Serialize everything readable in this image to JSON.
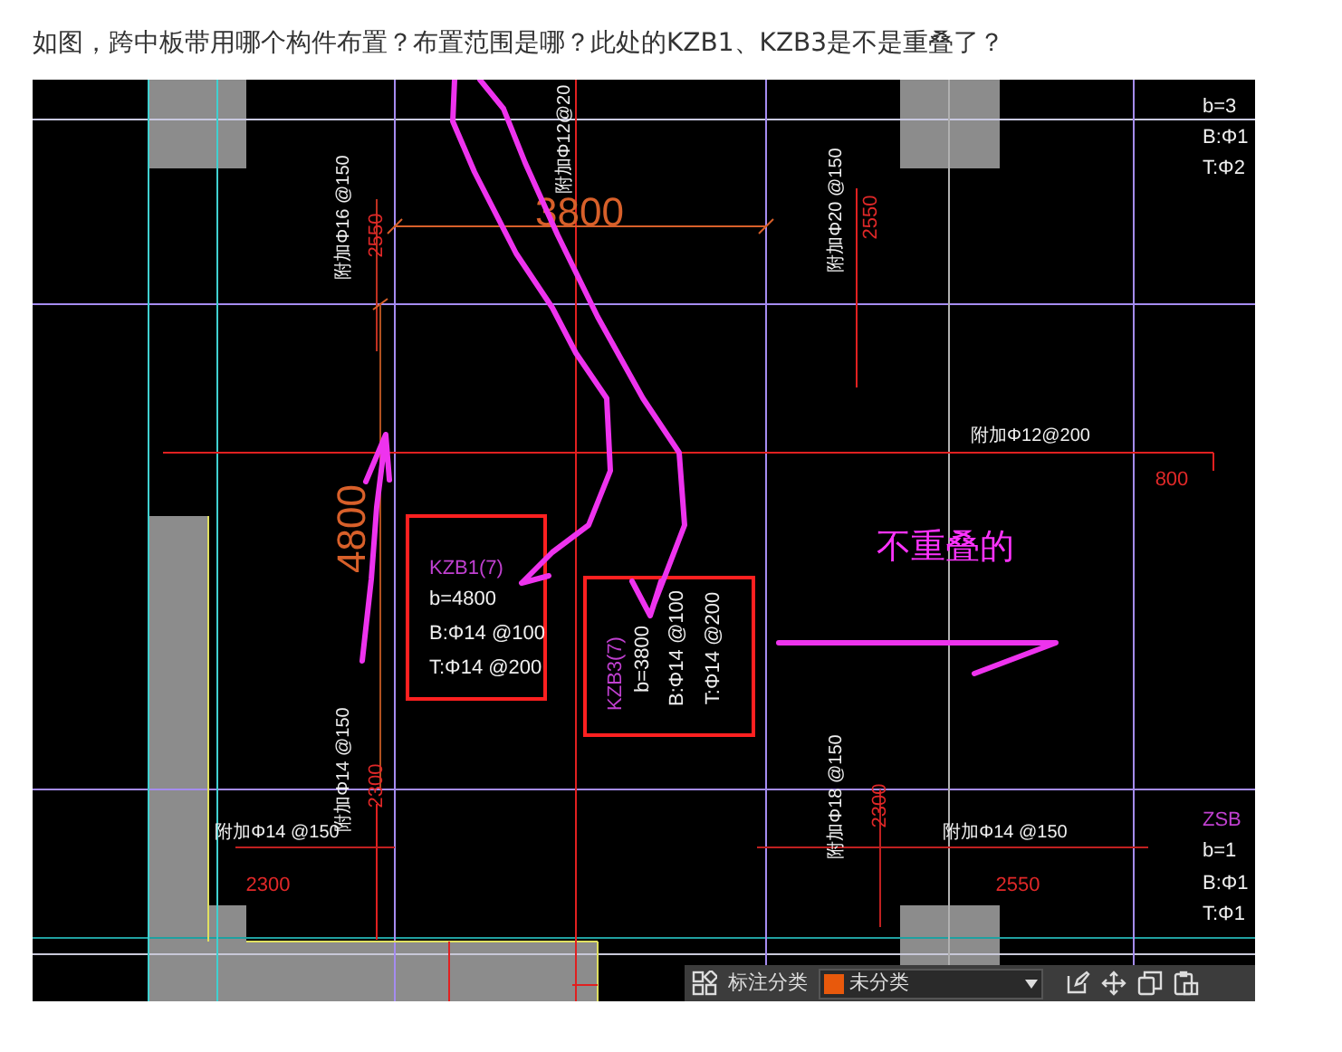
{
  "question": {
    "text": "如图，跨中板带用哪个构件布置？布置范围是哪？此处的KZB1、KZB3是不是重叠了？"
  },
  "cad_drawing": {
    "labels": [
      {
        "text": "附加Φ16 @150",
        "kind": "rebar"
      },
      {
        "text": "2550",
        "kind": "dimension"
      },
      {
        "text": "附加Φ12@20",
        "kind": "rebar"
      },
      {
        "text": "3800",
        "kind": "span"
      },
      {
        "text": "附加Φ20 @150",
        "kind": "rebar"
      },
      {
        "text": "2550",
        "kind": "dimension"
      },
      {
        "text": "b=3",
        "kind": "strip_spec"
      },
      {
        "text": "B:Φ1",
        "kind": "strip_spec"
      },
      {
        "text": "T:Φ2",
        "kind": "strip_spec"
      },
      {
        "text": "附加Φ12@200",
        "kind": "rebar"
      },
      {
        "text": "800",
        "kind": "dimension"
      },
      {
        "text": "4800",
        "kind": "span"
      },
      {
        "text": "KZB1(7)",
        "kind": "strip_name"
      },
      {
        "text": "b=4800",
        "kind": "strip_spec"
      },
      {
        "text": "B:Φ14 @100",
        "kind": "strip_spec"
      },
      {
        "text": "T:Φ14 @200",
        "kind": "strip_spec"
      },
      {
        "text": "KZB3(7)",
        "kind": "strip_name"
      },
      {
        "text": "b=3800",
        "kind": "strip_spec"
      },
      {
        "text": "B:Φ14 @100",
        "kind": "strip_spec"
      },
      {
        "text": "T:Φ14 @200",
        "kind": "strip_spec"
      },
      {
        "text": "不重叠的",
        "kind": "note"
      },
      {
        "text": "附加Φ14 @150",
        "kind": "rebar"
      },
      {
        "text": "2300",
        "kind": "dimension"
      },
      {
        "text": "附加Φ14 @150",
        "kind": "rebar"
      },
      {
        "text": "2300",
        "kind": "dimension"
      },
      {
        "text": "附加Φ18 @150",
        "kind": "rebar"
      },
      {
        "text": "2300",
        "kind": "dimension"
      },
      {
        "text": "附加Φ14 @150",
        "kind": "rebar"
      },
      {
        "text": "2550",
        "kind": "dimension"
      },
      {
        "text": "ZSB",
        "kind": "strip_name"
      },
      {
        "text": "b=1",
        "kind": "strip_spec"
      },
      {
        "text": "B:Φ1",
        "kind": "strip_spec"
      },
      {
        "text": "T:Φ1",
        "kind": "strip_spec"
      }
    ]
  },
  "toolbar": {
    "category_label": "标注分类",
    "category_value": "未分类"
  }
}
